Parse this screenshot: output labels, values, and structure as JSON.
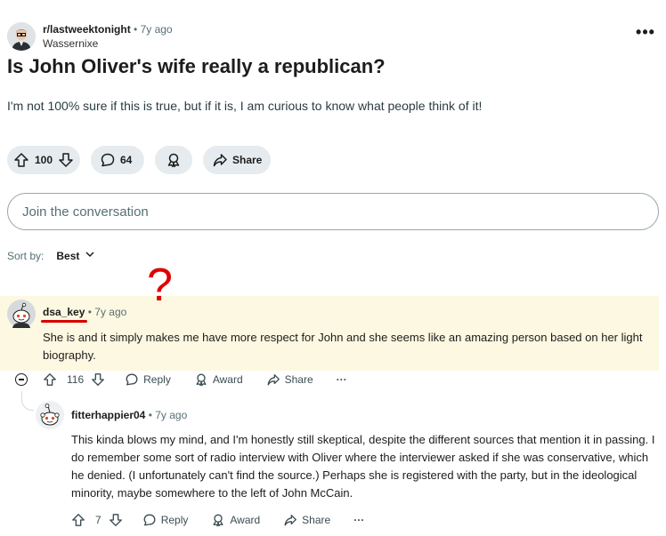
{
  "post": {
    "subreddit": "r/lastweektonight",
    "separator": "•",
    "time": "7y ago",
    "author": "Wassernixe",
    "title": "Is John Oliver's wife really a republican?",
    "body": "I'm not 100% sure if this is true, but if it is, I am curious to know what people think of it!",
    "votes": "100",
    "comments": "64",
    "share_label": "Share",
    "more_label": "•••"
  },
  "join_placeholder": "Join the conversation",
  "sort": {
    "label": "Sort by:",
    "value": "Best"
  },
  "annotation": {
    "mark": "?"
  },
  "comments": [
    {
      "username": "dsa_key",
      "separator": "•",
      "time": "7y ago",
      "text": "She is and it simply makes me have more respect for John and she seems like an amazing person based on her light biography.",
      "votes": "116",
      "reply_label": "Reply",
      "award_label": "Award",
      "share_label": "Share",
      "more_label": "···"
    },
    {
      "username": "fitterhappier04",
      "separator": "•",
      "time": "7y ago",
      "text": "This kinda blows my mind, and I'm honestly still skeptical, despite the different sources that mention it in passing. I do remember some sort of radio interview with Oliver where the interviewer asked if she was conservative, which he denied. (I unfortunately can't find the source.) Perhaps she is registered with the party, but in the ideological minority, maybe somewhere to the left of John McCain.",
      "votes": "7",
      "reply_label": "Reply",
      "award_label": "Award",
      "share_label": "Share",
      "more_label": "···"
    }
  ],
  "colors": {
    "highlight": "#fdf8e1",
    "pill": "#e5ebee",
    "annotation_red": "#e00000"
  }
}
